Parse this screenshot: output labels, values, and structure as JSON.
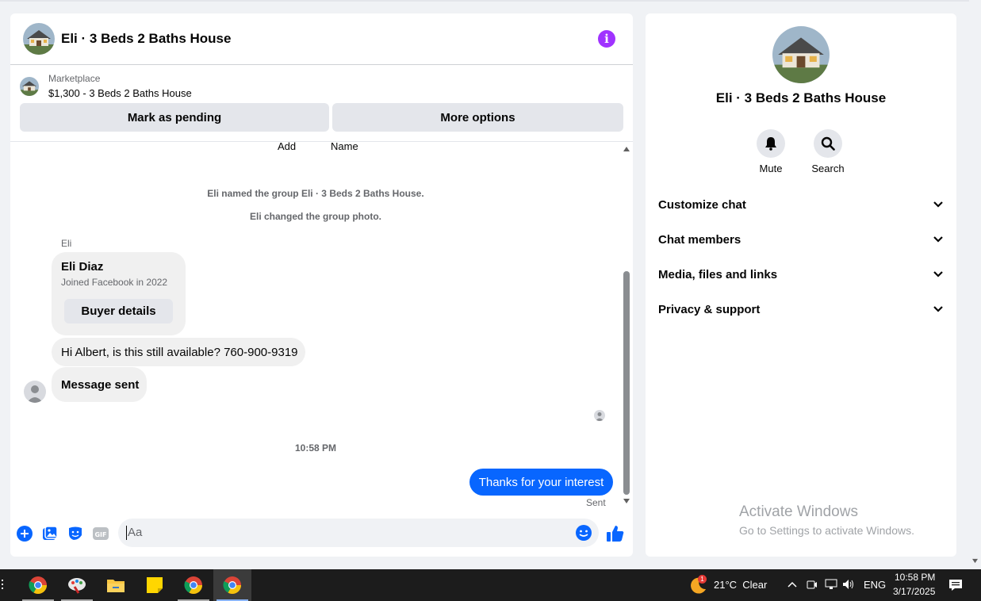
{
  "chat": {
    "title": "Eli · 3 Beds 2 Baths House",
    "marketplace_label": "Marketplace",
    "listing": "$1,300 - 3 Beds 2 Baths House",
    "mark_pending": "Mark as pending",
    "more_options": "More options",
    "add_label": "Add",
    "name_label": "Name",
    "system_1": "Eli named the group Eli · 3 Beds 2 Baths House.",
    "system_2": "Eli changed the group photo.",
    "sender_label": "Eli",
    "card_name": "Eli Diaz",
    "card_joined": "Joined Facebook in 2022",
    "buyer_details": "Buyer details",
    "msg_1": "Hi Albert, is this still available? 760-900-9319",
    "msg_2": "Message sent",
    "time": "10:58 PM",
    "my_msg": "Thanks for your interest",
    "sent_status": "Sent",
    "composer_placeholder": "Aa"
  },
  "side": {
    "title": "Eli · 3 Beds 2 Baths House",
    "mute": "Mute",
    "search": "Search",
    "sections": [
      "Customize chat",
      "Chat members",
      "Media, files and links",
      "Privacy & support"
    ],
    "activate_1": "Activate Windows",
    "activate_2": "Go to Settings to activate Windows."
  },
  "taskbar": {
    "weather": "21°C  Clear",
    "weather_badge": "1",
    "lang": "ENG",
    "clock": "10:58 PM",
    "date": "3/17/2025"
  },
  "colors": {
    "accent": "#0866ff",
    "info": "#a033ff"
  }
}
